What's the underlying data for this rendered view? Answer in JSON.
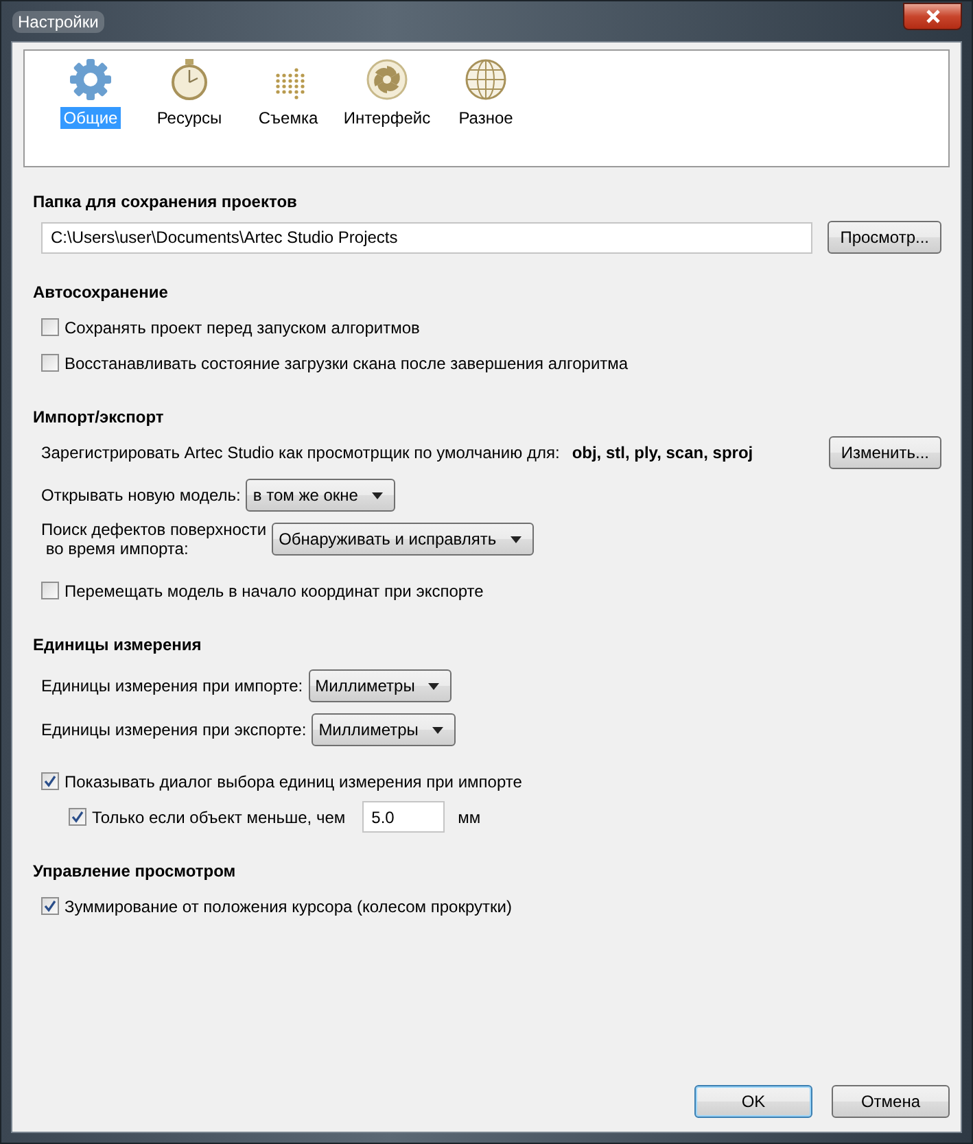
{
  "window": {
    "title": "Настройки"
  },
  "toolbar": [
    {
      "label": "Общие",
      "kind": "gear",
      "selected": true
    },
    {
      "label": "Ресурсы",
      "kind": "stopwatch",
      "selected": false
    },
    {
      "label": "Съемка",
      "kind": "dots",
      "selected": false
    },
    {
      "label": "Интерфейс",
      "kind": "aperture",
      "selected": false
    },
    {
      "label": "Разное",
      "kind": "globe",
      "selected": false
    }
  ],
  "sections": [
    {
      "title": "Папка для сохранения проектов",
      "rows": [
        {
          "kind": "path",
          "value": "C:\\Users\\user\\Documents\\Artec Studio Projects",
          "button": "Просмотр..."
        }
      ]
    },
    {
      "title": "Автосохранение",
      "rows": [
        {
          "kind": "checkbox",
          "label": "Сохранять проект перед запуском алгоритмов",
          "checked": false
        },
        {
          "kind": "checkbox",
          "label": "Восстанавливать состояние загрузки скана после завершения алгоритма",
          "checked": false
        }
      ]
    },
    {
      "title": "Импорт/экспорт",
      "rows": [
        {
          "kind": "register",
          "label": "Зарегистрировать Artec Studio как просмотрщик по умолчанию для:",
          "formats": "obj, stl, ply, scan, sproj",
          "button": "Изменить..."
        },
        {
          "kind": "select",
          "label": "Открывать новую модель:",
          "value": "в том же окне"
        },
        {
          "kind": "select",
          "label": "Поиск дефектов поверхности\n во время импорта:",
          "value": "Обнаруживать и исправлять"
        },
        {
          "kind": "checkbox",
          "label": "Перемещать модель в начало координат при экспорте",
          "checked": false
        }
      ]
    },
    {
      "title": "Единицы измерения",
      "rows": [
        {
          "kind": "select",
          "label": "Единицы измерения при импорте:",
          "value": "Миллиметры"
        },
        {
          "kind": "select",
          "label": "Единицы измерения при экспорте:",
          "value": "Миллиметры"
        },
        {
          "kind": "checkbox",
          "label": "Показывать диалог выбора единиц измерения при импорте",
          "checked": true,
          "children": [
            {
              "kind": "checkbox_input",
              "label": "Только если объект меньше, чем",
              "checked": true,
              "value": "5.0",
              "unit": "мм"
            }
          ]
        }
      ]
    },
    {
      "title": "Управление просмотром",
      "rows": [
        {
          "kind": "checkbox",
          "label": "Зуммирование от положения курсора (колесом прокрутки)",
          "checked": true
        }
      ]
    }
  ],
  "buttons": [
    "OK",
    "Отмена"
  ]
}
